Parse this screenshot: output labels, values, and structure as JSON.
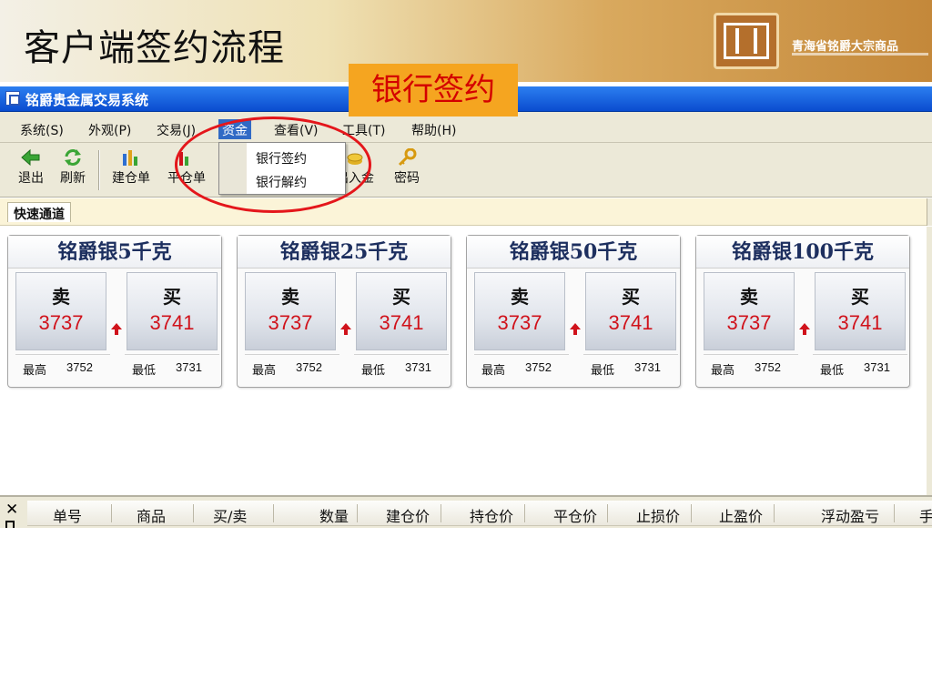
{
  "slide": {
    "title": "客户端签约流程",
    "logo_text": "青海省铭爵大宗商品"
  },
  "callout": {
    "text": "银行签约"
  },
  "window": {
    "title": "铭爵贵金属交易系统"
  },
  "menu": [
    {
      "label": "系统(S)"
    },
    {
      "label": "外观(P)"
    },
    {
      "label": "交易(J)"
    },
    {
      "label": "资金"
    },
    {
      "label": "查看(V)"
    },
    {
      "label": "工具(T)"
    },
    {
      "label": "帮助(H)"
    }
  ],
  "dropdown": [
    {
      "label": "银行签约"
    },
    {
      "label": "银行解约"
    }
  ],
  "toolbar": [
    {
      "label": "退出"
    },
    {
      "label": "刷新"
    },
    {
      "label": "建仓单"
    },
    {
      "label": "平仓单"
    },
    {
      "label": "出入金"
    },
    {
      "label": "密码"
    }
  ],
  "quickbar": {
    "tab": "快速通道"
  },
  "products": [
    {
      "name": "铭爵银5千克",
      "sell_label": "卖",
      "buy_label": "买",
      "sell": "3737",
      "buy": "3741",
      "high_label": "最高",
      "high": "3752",
      "low_label": "最低",
      "low": "3731"
    },
    {
      "name": "铭爵银25千克",
      "sell_label": "卖",
      "buy_label": "买",
      "sell": "3737",
      "buy": "3741",
      "high_label": "最高",
      "high": "3752",
      "low_label": "最低",
      "low": "3731"
    },
    {
      "name": "铭爵银50千克",
      "sell_label": "卖",
      "buy_label": "买",
      "sell": "3737",
      "buy": "3741",
      "high_label": "最高",
      "high": "3752",
      "low_label": "最低",
      "low": "3731"
    },
    {
      "name": "铭爵银100千克",
      "sell_label": "卖",
      "buy_label": "买",
      "sell": "3737",
      "buy": "3741",
      "high_label": "最高",
      "high": "3752",
      "low_label": "最低",
      "low": "3731"
    }
  ],
  "table": {
    "columns": [
      "单号",
      "商品",
      "买/卖",
      "数量",
      "建仓价",
      "持仓价",
      "平仓价",
      "止损价",
      "止盈价",
      "浮动盈亏",
      "手"
    ]
  },
  "colors": {
    "price_red": "#d0121b",
    "highlight_circle": "#e4161b",
    "callout_bg": "#f5a520"
  }
}
